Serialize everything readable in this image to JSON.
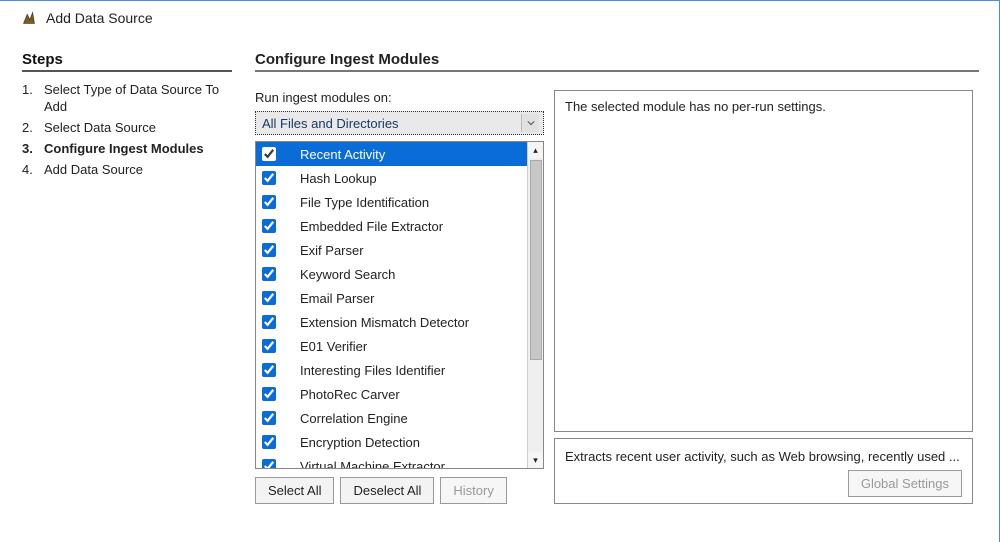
{
  "window": {
    "title": "Add Data Source"
  },
  "steps": {
    "header": "Steps",
    "items": [
      {
        "num": "1.",
        "label": "Select Type of Data Source To Add",
        "active": false
      },
      {
        "num": "2.",
        "label": "Select Data Source",
        "active": false
      },
      {
        "num": "3.",
        "label": "Configure Ingest Modules",
        "active": true
      },
      {
        "num": "4.",
        "label": "Add Data Source",
        "active": false
      }
    ]
  },
  "main": {
    "header": "Configure Ingest Modules",
    "run_label": "Run ingest modules on:",
    "dropdown": {
      "selected": "All Files and Directories"
    },
    "modules": [
      {
        "label": "Recent Activity",
        "checked": true,
        "selected": true
      },
      {
        "label": "Hash Lookup",
        "checked": true,
        "selected": false
      },
      {
        "label": "File Type Identification",
        "checked": true,
        "selected": false
      },
      {
        "label": "Embedded File Extractor",
        "checked": true,
        "selected": false
      },
      {
        "label": "Exif Parser",
        "checked": true,
        "selected": false
      },
      {
        "label": "Keyword Search",
        "checked": true,
        "selected": false
      },
      {
        "label": "Email Parser",
        "checked": true,
        "selected": false
      },
      {
        "label": "Extension Mismatch Detector",
        "checked": true,
        "selected": false
      },
      {
        "label": "E01 Verifier",
        "checked": true,
        "selected": false
      },
      {
        "label": "Interesting Files Identifier",
        "checked": true,
        "selected": false
      },
      {
        "label": "PhotoRec Carver",
        "checked": true,
        "selected": false
      },
      {
        "label": "Correlation Engine",
        "checked": true,
        "selected": false
      },
      {
        "label": "Encryption Detection",
        "checked": true,
        "selected": false
      },
      {
        "label": "Virtual Machine Extractor",
        "checked": true,
        "selected": false
      }
    ],
    "buttons": {
      "select_all": "Select All",
      "deselect_all": "Deselect All",
      "history": "History"
    },
    "settings_text": "The selected module has no per-run settings.",
    "description": "Extracts recent user activity, such as Web browsing, recently used ...",
    "global_settings": "Global Settings"
  }
}
